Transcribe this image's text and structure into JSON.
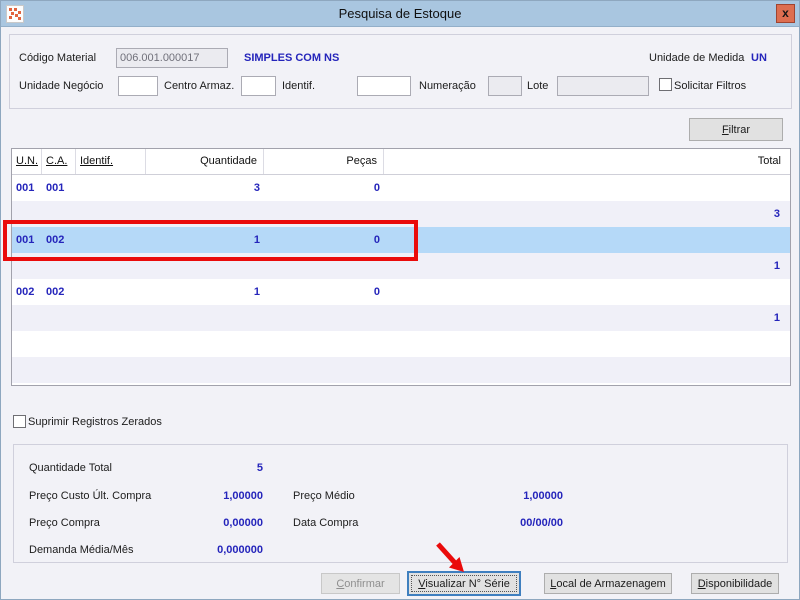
{
  "window": {
    "title": "Pesquisa de Estoque",
    "close_label": "x"
  },
  "filters": {
    "codigo_material_label": "Código Material",
    "codigo_material_value": "006.001.000017",
    "material_description": "SIMPLES COM NS",
    "unidade_medida_label": "Unidade de Medida",
    "unidade_medida_value": "UN",
    "unidade_negocio_label": "Unidade Negócio",
    "centro_armaz_label": "Centro Armaz.",
    "identif_label": "Identif.",
    "numeracao_label": "Numeração",
    "lote_label": "Lote",
    "solicitar_filtros_label": "Solicitar Filtros",
    "filtrar_button": "Filtrar"
  },
  "table": {
    "headers": {
      "un": "U.N.",
      "ca": "C.A.",
      "identif": "Identif.",
      "quantidade": "Quantidade",
      "pecas": "Peças",
      "total": "Total"
    },
    "rows": [
      {
        "un": "001",
        "ca": "001",
        "quantidade": "3",
        "pecas": "0"
      },
      {
        "total": "3"
      },
      {
        "un": "001",
        "ca": "002",
        "quantidade": "1",
        "pecas": "0"
      },
      {
        "total": "1"
      },
      {
        "un": "002",
        "ca": "002",
        "quantidade": "1",
        "pecas": "0"
      },
      {
        "total": "1"
      }
    ]
  },
  "options": {
    "suprimir_label": "Suprimir Registros Zerados"
  },
  "stats": {
    "quantidade_total_label": "Quantidade Total",
    "quantidade_total_value": "5",
    "preco_custo_label": "Preço Custo Últ. Compra",
    "preco_custo_value": "1,00000",
    "preco_medio_label": "Preço Médio",
    "preco_medio_value": "1,00000",
    "preco_compra_label": "Preço Compra",
    "preco_compra_value": "0,00000",
    "data_compra_label": "Data Compra",
    "data_compra_value": "00/00/00",
    "demanda_label": "Demanda Média/Mês",
    "demanda_value": "0,000000"
  },
  "actions": {
    "confirmar": "Confirmar",
    "visualizar_serie": "Visualizar N° Série",
    "local_armazenagem": "Local de Armazenagem",
    "disponibilidade": "Disponibilidade"
  },
  "colors": {
    "titlebar": "#a9c6e0",
    "value_blue": "#2525bb",
    "selection_blue": "#b5d9f8",
    "annotation_red": "#ea0b0b",
    "close_button": "#dd6e50"
  }
}
